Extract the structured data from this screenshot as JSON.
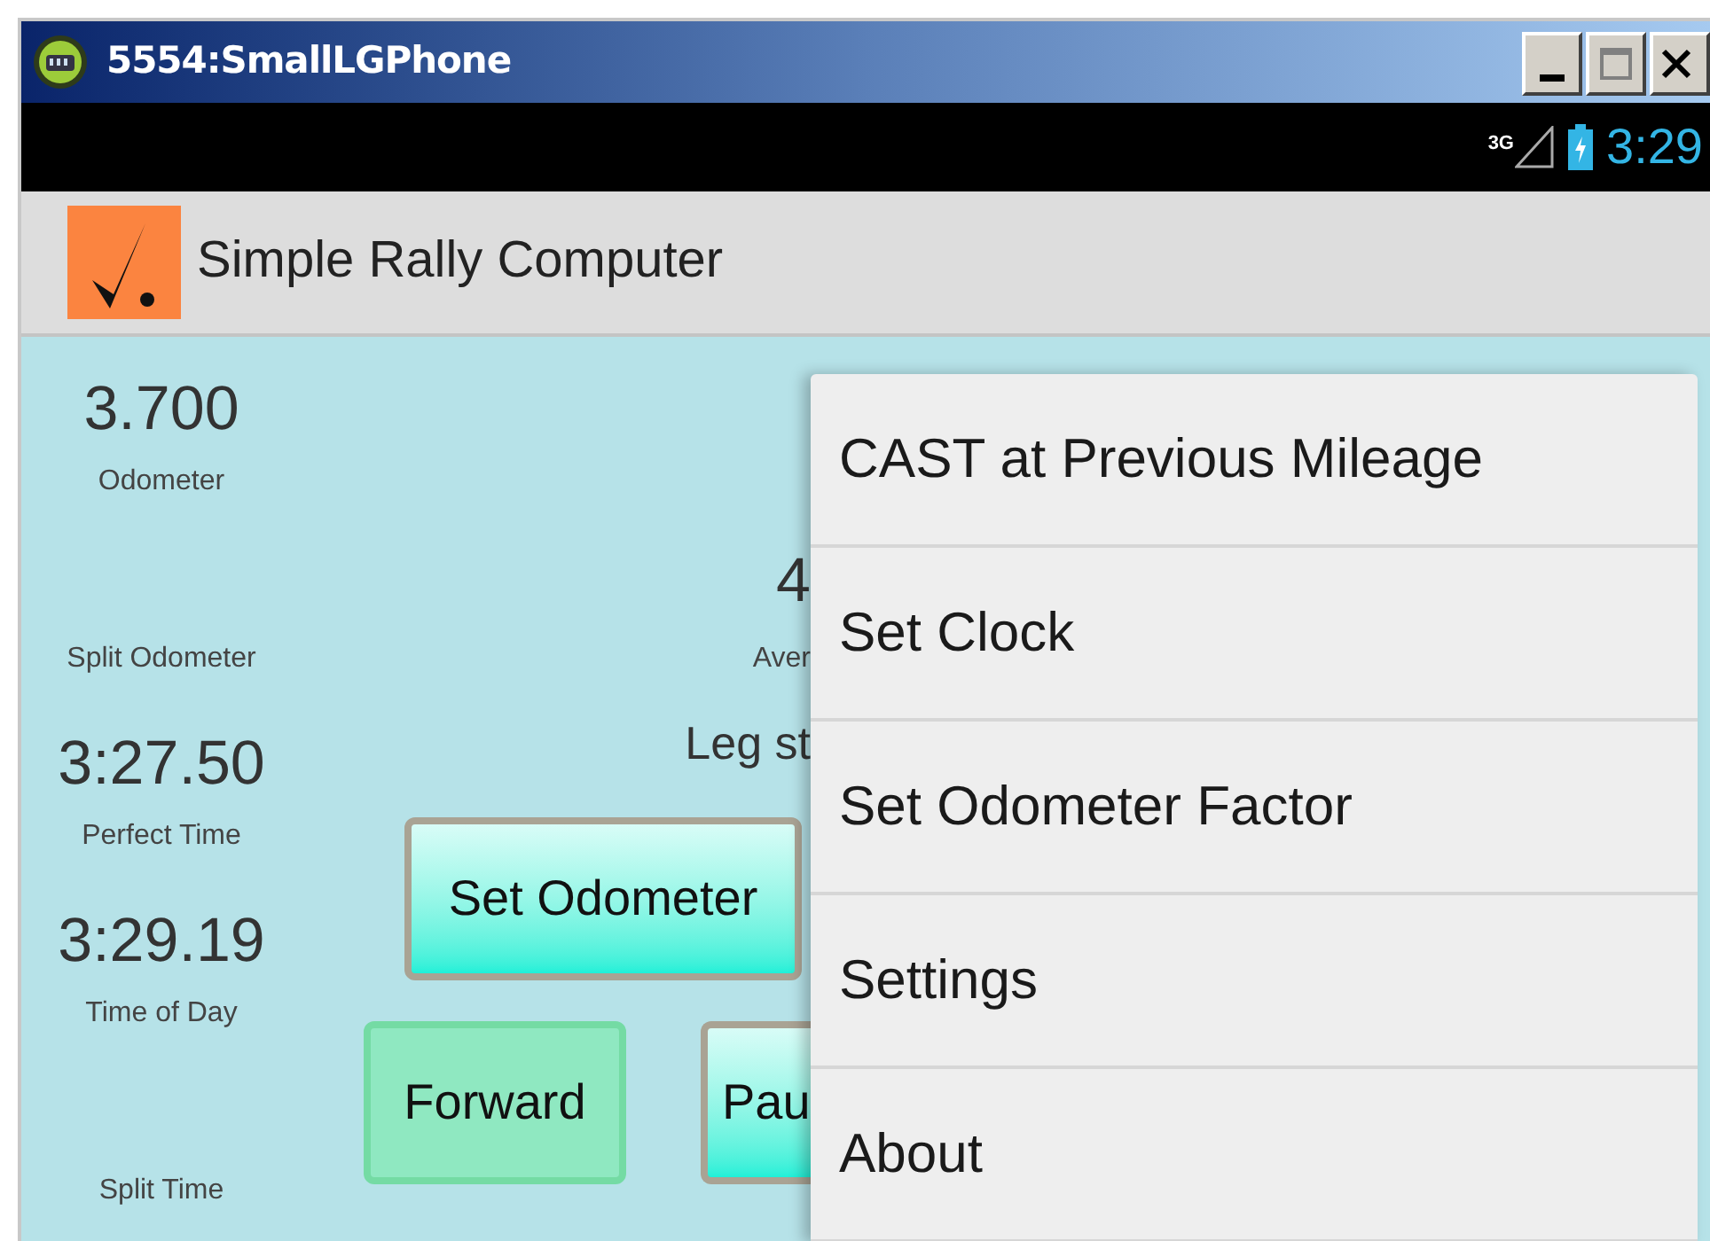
{
  "window": {
    "title": "5554:SmallLGPhone"
  },
  "status_bar": {
    "network": "3G",
    "time": "3:29"
  },
  "action_bar": {
    "title": "Simple Rally Computer"
  },
  "readouts": [
    {
      "value": "3.700",
      "label": "Odometer"
    },
    {
      "label": "Split Odometer"
    },
    {
      "value": "3:27.50",
      "label": "Perfect Time"
    },
    {
      "value": "3:29.19",
      "label": "Time of Day"
    },
    {
      "label": "Split Time"
    }
  ],
  "average": {
    "value": "4",
    "label": "Aver"
  },
  "leg_status": "Leg st",
  "buttons": [
    {
      "label": "Set Odometer",
      "kind": "gradient"
    },
    {
      "label": "Forward",
      "kind": "flat"
    },
    {
      "label": "Pau",
      "kind": "gradient"
    }
  ],
  "menu": [
    {
      "label": "CAST at Previous Mileage"
    },
    {
      "label": "Set Clock"
    },
    {
      "label": "Set Odometer Factor"
    },
    {
      "label": "Settings"
    },
    {
      "label": "About"
    }
  ]
}
